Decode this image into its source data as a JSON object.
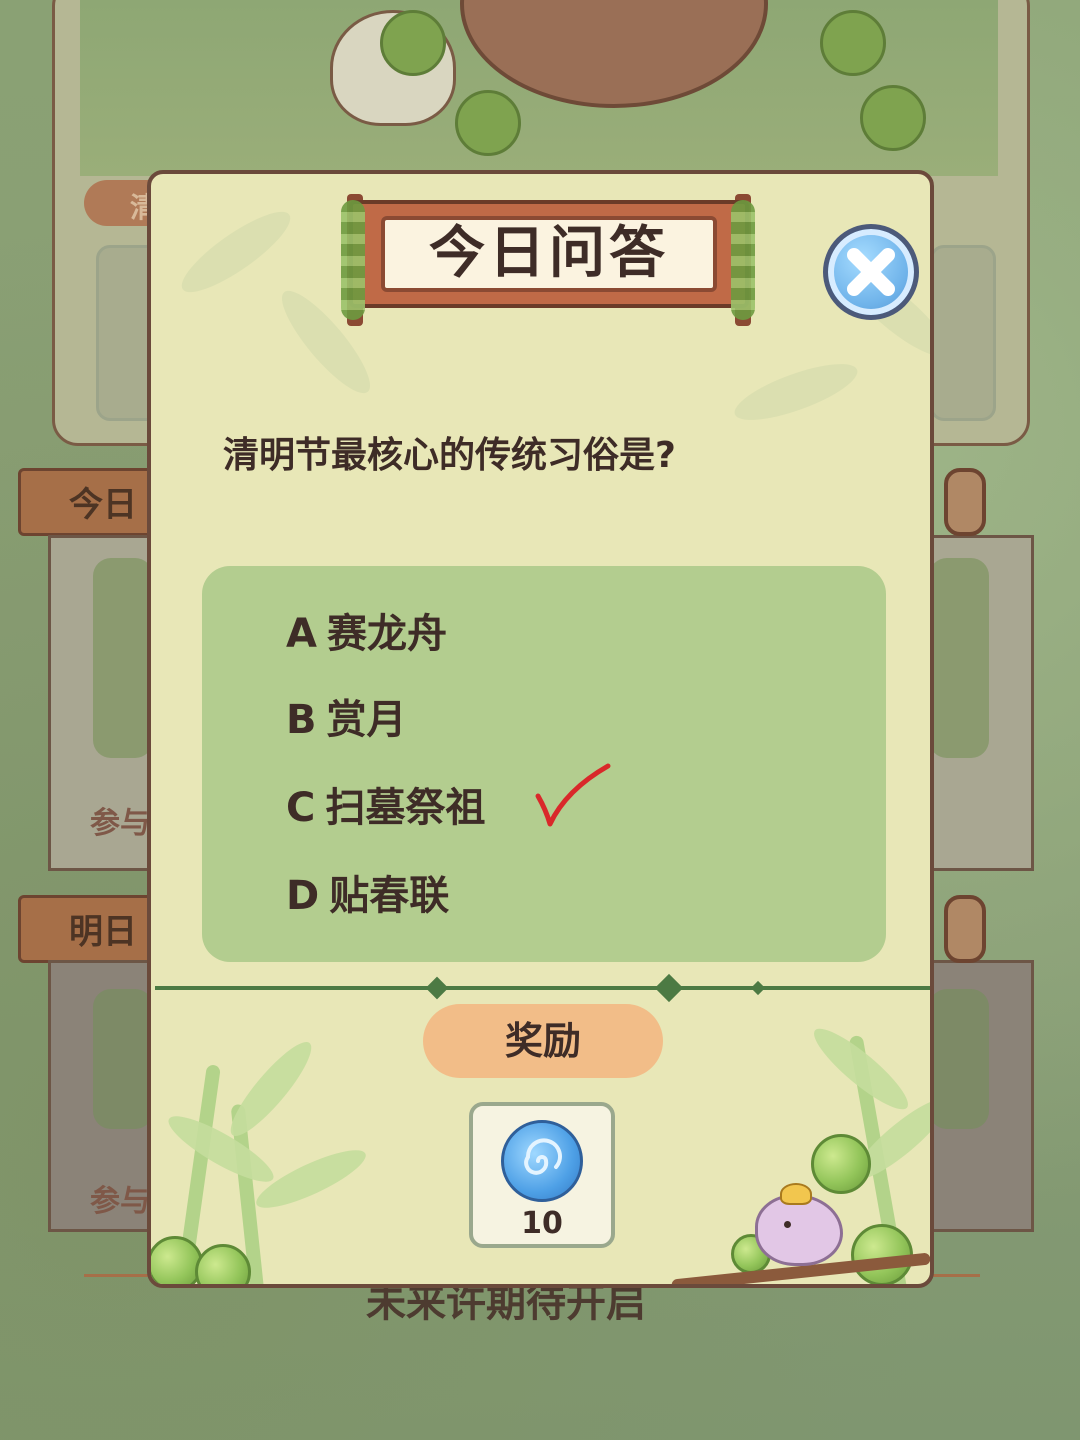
{
  "background": {
    "section_labels": [
      "今日",
      "明日"
    ],
    "side_labels": [
      "参与",
      "参与"
    ],
    "footer_text": "未来许期待开启",
    "corner_tab": "清"
  },
  "modal": {
    "title": "今日问答",
    "close_icon": "close-icon",
    "question": "清明节最核心的传统习俗是?",
    "options": [
      {
        "letter": "A",
        "text": "赛龙舟",
        "selected": false
      },
      {
        "letter": "B",
        "text": "赏月",
        "selected": false
      },
      {
        "letter": "C",
        "text": "扫墓祭祖",
        "selected": true
      },
      {
        "letter": "D",
        "text": "贴春联",
        "selected": false
      }
    ],
    "reward_label": "奖励",
    "reward_item": {
      "icon": "blue-swirl-orb-icon",
      "count": "10"
    }
  },
  "colors": {
    "modal_bg": "#e8e7b7",
    "options_bg": "#b3cd8f",
    "reward_pill": "#f2bd88",
    "check_mark": "#d9282a",
    "title_frame": "#c06a47",
    "divider": "#4c7a43"
  }
}
